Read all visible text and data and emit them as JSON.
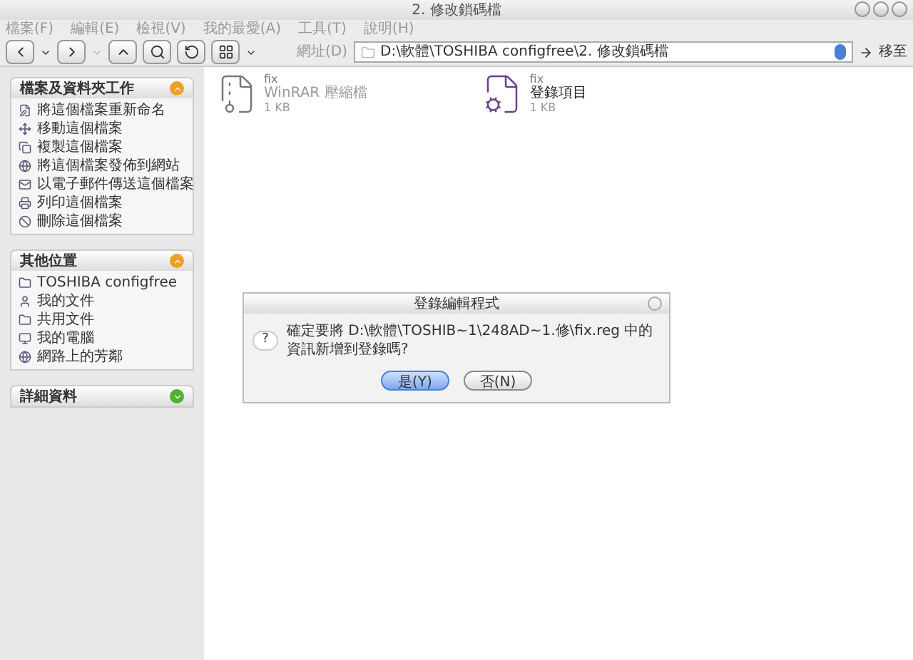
{
  "window": {
    "title": "2. 修改鎖碼檔"
  },
  "menu": [
    "檔案(F)",
    "編輯(E)",
    "檢視(V)",
    "我的最愛(A)",
    "工具(T)",
    "說明(H)"
  ],
  "address": {
    "label": "網址(D)",
    "value": "D:\\軟體\\TOSHIBA configfree\\2. 修改鎖碼檔",
    "go": "移至"
  },
  "panels": [
    {
      "title": "檔案及資料夾工作",
      "expanded": true,
      "color": "#f0a020",
      "items": [
        {
          "label": "將這個檔案重新命名",
          "kind": "rename"
        },
        {
          "label": "移動這個檔案",
          "kind": "move"
        },
        {
          "label": "複製這個檔案",
          "kind": "copy"
        },
        {
          "label": "將這個檔案發佈到網站",
          "kind": "web"
        },
        {
          "label": "以電子郵件傳送這個檔案",
          "kind": "mail"
        },
        {
          "label": "列印這個檔案",
          "kind": "print"
        },
        {
          "label": "刪除這個檔案",
          "kind": "delete"
        }
      ]
    },
    {
      "title": "其他位置",
      "expanded": true,
      "color": "#f0a020",
      "items": [
        {
          "label": "TOSHIBA configfree",
          "kind": "folder"
        },
        {
          "label": "我的文件",
          "kind": "docs"
        },
        {
          "label": "共用文件",
          "kind": "folder"
        },
        {
          "label": "我的電腦",
          "kind": "computer"
        },
        {
          "label": "網路上的芳鄰",
          "kind": "web"
        }
      ]
    },
    {
      "title": "詳細資料",
      "expanded": false,
      "color": "#50b030"
    }
  ],
  "files": [
    {
      "name": "fix",
      "type": "WinRAR 壓縮檔",
      "size": "1 KB",
      "kind": "archive"
    },
    {
      "name": "fix",
      "type": "登錄項目",
      "size": "1 KB",
      "kind": "registry"
    }
  ],
  "dialog": {
    "title": "登錄編輯程式",
    "icon": "?",
    "message": "確定要將 D:\\軟體\\TOSHIB~1\\248AD~1.修\\fix.reg 中的資訊新增到登錄嗎?",
    "buttons": [
      {
        "label": "是(Y)",
        "selected": true
      },
      {
        "label": "否(N)",
        "selected": false
      }
    ]
  }
}
